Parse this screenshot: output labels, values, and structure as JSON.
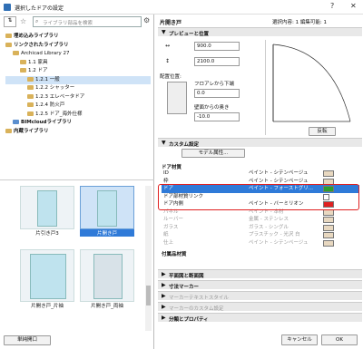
{
  "window": {
    "title": "選択したドアの設定"
  },
  "left": {
    "search_placeholder": "ライブラリ部品を検索",
    "tree": [
      {
        "label": "埋め込みライブラリ",
        "bold": true,
        "indent": 0
      },
      {
        "label": "リンクされたライブラリ",
        "bold": true,
        "indent": 0
      },
      {
        "label": "Archicad Library 27",
        "bold": false,
        "indent": 1
      },
      {
        "label": "1.1 家具",
        "bold": false,
        "indent": 2
      },
      {
        "label": "1.2 ドア",
        "bold": false,
        "indent": 2
      },
      {
        "label": "1.2.1 一般",
        "bold": false,
        "indent": 3
      },
      {
        "label": "1.2.2 シャッター",
        "bold": false,
        "indent": 3
      },
      {
        "label": "1.2.3 エレベータドア",
        "bold": false,
        "indent": 3
      },
      {
        "label": "1.2.4 防火戸",
        "bold": false,
        "indent": 3
      },
      {
        "label": "1.2.5 ドア_海外仕様",
        "bold": false,
        "indent": 3
      },
      {
        "label": "BIMcloudライブラリ",
        "bold": true,
        "indent": 1
      },
      {
        "label": "内蔵ライブラリ",
        "bold": true,
        "indent": 0
      }
    ],
    "thumbs": [
      "片引き戸3",
      "片開き戸",
      "片開き戸_片袖",
      "片開き戸_両袖"
    ],
    "bottom_button": "単純開口"
  },
  "right": {
    "header_title": "片開き戸",
    "header_status": "選択内容: 1 編集可能: 1",
    "preview_section": "プレビューと位置",
    "width_value": "900.0",
    "height_value": "2100.0",
    "anchor_label": "配置位置:",
    "floor_label": "フロアレから下端",
    "floor_value": "0.0",
    "wall_label": "壁面からの奥き",
    "wall_value": "-10.0",
    "flip_button": "反転",
    "custom_section": "カスタム設定",
    "model_label": "モデル属性...",
    "door_material_header": "ドア材質",
    "materials": [
      {
        "name": "ID",
        "value": "ペイント - シテンページュ"
      },
      {
        "name": "枠",
        "value": "ペイント - シテンページュ"
      },
      {
        "name": "ドア",
        "value": "ペイント - フォーストグリ..."
      },
      {
        "name": "ドア部材質リンク",
        "value": ""
      },
      {
        "name": "ドア内側",
        "value": "ペイント - バーミリオン"
      },
      {
        "name": "パネル",
        "value": "ペイント - 本材"
      },
      {
        "name": "ルーバー",
        "value": "金属 - ステンレス"
      },
      {
        "name": "ガラス",
        "value": "ガラス - シングル"
      },
      {
        "name": "紙",
        "value": "プラスチック - 光沢 白"
      },
      {
        "name": "仕上",
        "value": "ペイント - シテンページュ"
      }
    ],
    "accessory_header": "付属品材質",
    "collapsed_sections": [
      "平面図と断面図",
      "寸法マーカー",
      "マーカーテキストスタイル",
      "マーカーのカスタム設定",
      "分類とプロパティ"
    ],
    "cancel_button": "キャンセル",
    "ok_button": "OK"
  },
  "colors": {
    "accent": "#2f6fb5",
    "highlight": "#2f7ad8",
    "red": "#e02020",
    "green": "#2ca02c"
  }
}
